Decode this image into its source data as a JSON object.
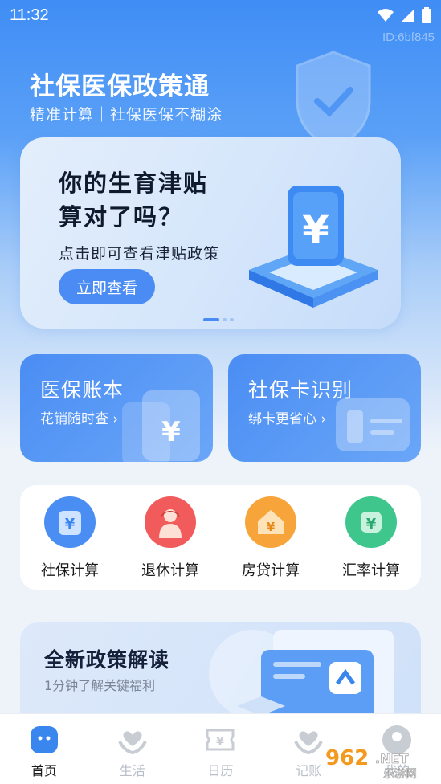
{
  "status": {
    "time": "11:32"
  },
  "watermark": "ID:6bf845",
  "header": {
    "title": "社保医保政策通",
    "subtitle": "精准计算｜社保医保不糊涂"
  },
  "banner": {
    "title_line1": "你的生育津贴",
    "title_line2": "算对了吗？",
    "subtitle": "点击即可查看津贴政策",
    "button": "立即查看",
    "slide_count": 3,
    "active_slide": 1
  },
  "features": [
    {
      "title": "医保账本",
      "subtitle": "花销随时查"
    },
    {
      "title": "社保卡识别",
      "subtitle": "绑卡更省心"
    }
  ],
  "tools": [
    {
      "label": "社保计算",
      "icon": "yen-card-icon",
      "color": "#4a8df3"
    },
    {
      "label": "退休计算",
      "icon": "retiree-icon",
      "color": "#f25b5b"
    },
    {
      "label": "房贷计算",
      "icon": "house-yen-icon",
      "color": "#f7a53a"
    },
    {
      "label": "汇率计算",
      "icon": "yen-badge-icon",
      "color": "#3ec68c"
    }
  ],
  "policy": {
    "title": "全新政策解读",
    "subtitle": "1分钟了解关键福利"
  },
  "tabs": [
    {
      "label": "首页",
      "icon": "home-icon",
      "active": true
    },
    {
      "label": "生活",
      "icon": "heart-hands-icon",
      "active": false
    },
    {
      "label": "日历",
      "icon": "ticket-yen-icon",
      "active": false
    },
    {
      "label": "记账",
      "icon": "heart-hands-icon",
      "active": false
    },
    {
      "label": "我的",
      "icon": "user-icon",
      "active": false
    }
  ],
  "brand_watermark": {
    "number": "962",
    "suffix": ".NET",
    "text": "乐游网"
  },
  "colors": {
    "primary": "#4a8cf3",
    "accent_blue": "#3f8df5"
  }
}
